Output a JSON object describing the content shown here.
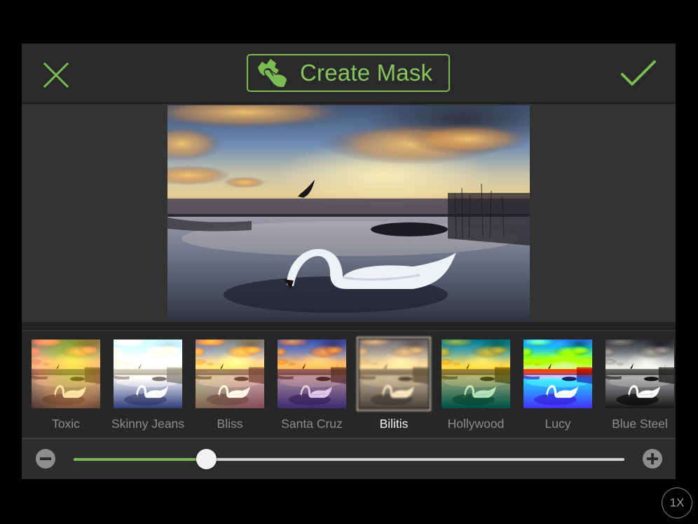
{
  "colors": {
    "accent": "#7bbb52",
    "panel_bg": "#2b2b2b",
    "selected_border": "#a8a8a8",
    "slider_fill": "#7bb454"
  },
  "header": {
    "close_icon": "close-x-icon",
    "create_mask_label": "Create Mask",
    "create_mask_icon": "finger-paint-hand-icon",
    "done_icon": "checkmark-icon"
  },
  "canvas": {
    "image_description": "Swan feeding on a lake at sunset with a bird flying in the sky"
  },
  "filters": {
    "selected": "Bilitis",
    "items": [
      {
        "label": "Toxic",
        "selected": false
      },
      {
        "label": "Skinny Jeans",
        "selected": false
      },
      {
        "label": "Bliss",
        "selected": false
      },
      {
        "label": "Santa Cruz",
        "selected": false
      },
      {
        "label": "Bilitis",
        "selected": true
      },
      {
        "label": "Hollywood",
        "selected": false
      },
      {
        "label": "Lucy",
        "selected": false
      },
      {
        "label": "Blue Steel",
        "selected": false
      }
    ]
  },
  "slider": {
    "minus_icon": "minus-circle-icon",
    "plus_icon": "plus-circle-icon",
    "value_percent": 24
  },
  "zoom_badge": "1X"
}
